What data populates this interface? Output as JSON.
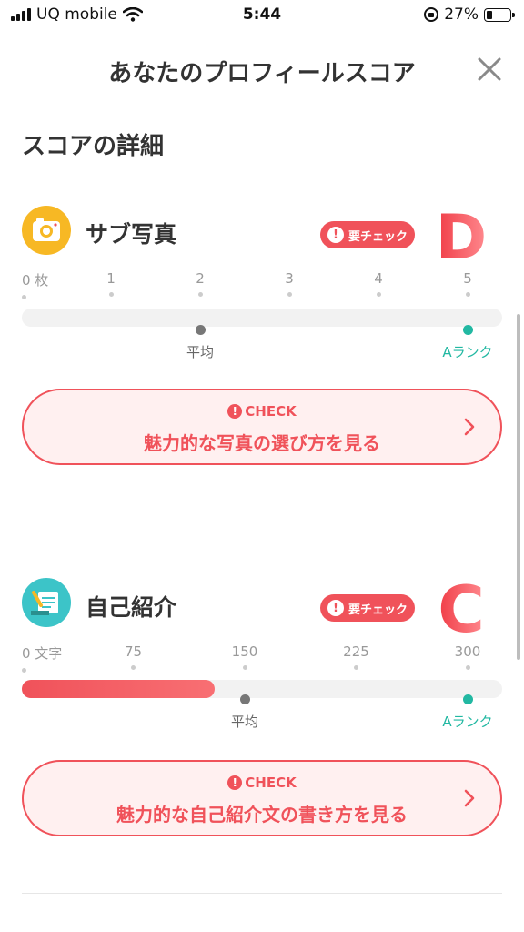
{
  "status_bar": {
    "carrier": "UQ mobile",
    "time": "5:44",
    "battery_percent": "27%",
    "battery_level": 0.27
  },
  "header": {
    "title": "あなたのプロフィールスコア",
    "close_icon": "close-icon"
  },
  "section_title": "スコアの詳細",
  "colors": {
    "accent": "#f0525a",
    "teal": "#22b8a2",
    "gray_marker": "#777777"
  },
  "cards": [
    {
      "label": "サブ写真",
      "icon": "camera-icon",
      "badge": "要チェック",
      "grade": "D",
      "ticks": [
        "0",
        "1",
        "2",
        "3",
        "4",
        "5"
      ],
      "tick_unit": "枚",
      "value": 0,
      "average": 2,
      "a_rank": 5,
      "max": 5,
      "average_label": "平均",
      "a_rank_label": "Aランク",
      "cta_top": "CHECK",
      "cta_main": "魅力的な写真の選び方を見る"
    },
    {
      "label": "自己紹介",
      "icon": "memo-icon",
      "badge": "要チェック",
      "grade": "C",
      "ticks": [
        "0",
        "75",
        "150",
        "225",
        "300"
      ],
      "tick_unit": "文字",
      "value": 130,
      "average": 150,
      "a_rank": 300,
      "max": 300,
      "average_label": "平均",
      "a_rank_label": "Aランク",
      "cta_top": "CHECK",
      "cta_main": "魅力的な自己紹介文の書き方を見る"
    }
  ]
}
